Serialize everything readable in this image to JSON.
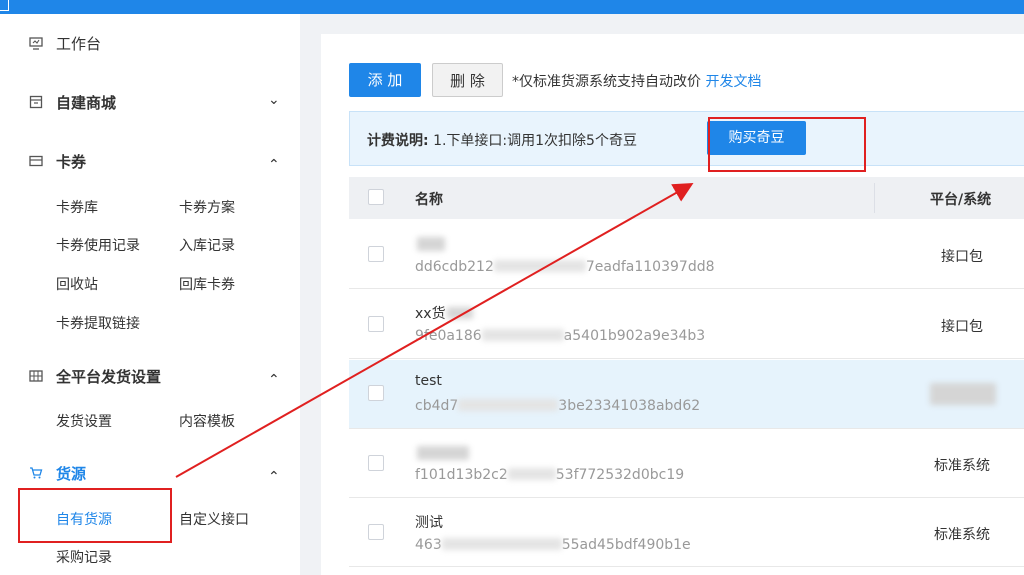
{
  "sidebar": {
    "workbench": "工作台",
    "self_mall": "自建商城",
    "coupon": "卡券",
    "coupon_lib": "卡券库",
    "coupon_plan": "卡券方案",
    "coupon_usage": "卡券使用记录",
    "stock_in_record": "入库记录",
    "recycle_bin": "回收站",
    "return_coupon": "回库卡券",
    "coupon_link": "卡券提取链接",
    "delivery_settings_group": "全平台发货设置",
    "delivery_settings": "发货设置",
    "content_template": "内容模板",
    "source": "货源",
    "own_source": "自有货源",
    "custom_api": "自定义接口",
    "purchase_record": "采购记录"
  },
  "toolbar": {
    "add_label": "添 加",
    "delete_label": "删 除",
    "note_text": "*仅标准货源系统支持自动改价",
    "dev_doc_link": "开发文档"
  },
  "fee": {
    "title": "计费说明:",
    "text": "1.下单接口:调用1次扣除5个奇豆",
    "buy_label": "购买奇豆"
  },
  "table": {
    "col_name": "名称",
    "col_platform": "平台/系统",
    "rows": [
      {
        "name": "",
        "id_prefix": "dd6cdb212",
        "id_suffix": "7eadfa110397dd8",
        "platform": "接口包"
      },
      {
        "name": "xx货",
        "id_prefix": "9fe0a186",
        "id_suffix": "a5401b902a9e34b3",
        "platform": "接口包"
      },
      {
        "name": "test",
        "id_prefix": "cb4d7",
        "id_suffix": "3be23341038abd62",
        "platform": ""
      },
      {
        "name": "",
        "id_prefix": "f101d13b2c2",
        "id_suffix": "53f772532d0bc19",
        "platform": "标准系统"
      },
      {
        "name": "测试",
        "id_prefix": "463",
        "id_suffix": "55ad45bdf490b1e",
        "platform": "标准系统"
      }
    ]
  },
  "colors": {
    "accent": "#1f86e8",
    "annotation": "#e02020",
    "highlight_row": "#e6f3fc"
  }
}
